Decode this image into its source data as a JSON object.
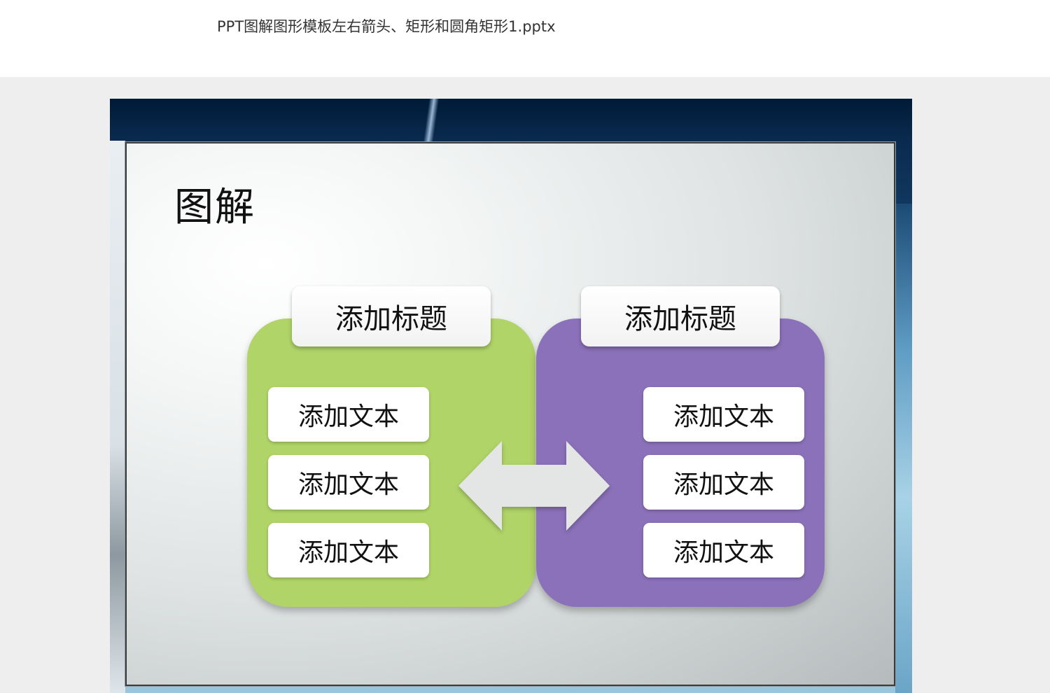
{
  "window": {
    "file_title": "PPT图解图形模板左右箭头、矩形和圆角矩形1.pptx"
  },
  "slide": {
    "heading": "图解",
    "left_panel": {
      "title": "添加标题",
      "items": [
        "添加文本",
        "添加文本",
        "添加文本"
      ],
      "color": "#b0d468"
    },
    "right_panel": {
      "title": "添加标题",
      "items": [
        "添加文本",
        "添加文本",
        "添加文本"
      ],
      "color": "#8b71b9"
    },
    "arrow_icon": "left-right-arrow-icon"
  }
}
